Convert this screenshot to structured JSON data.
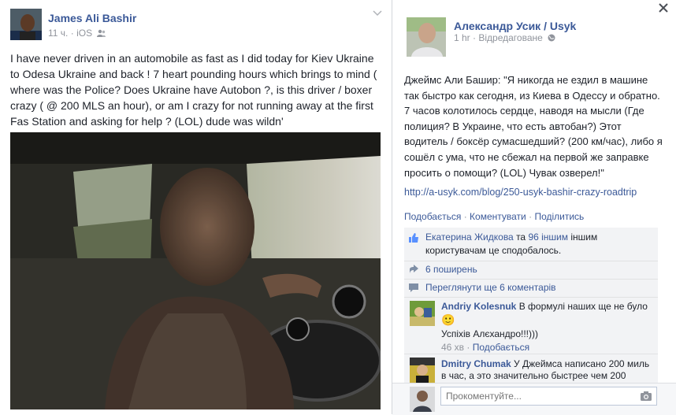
{
  "left_post": {
    "author": "James Ali Bashir",
    "time": "11 ч.",
    "source": "iOS",
    "text": "I have never driven in an automobile as fast as I did today for Kiev Ukraine\nto Odesa Ukraine and back ! 7 heart pounding hours which brings to mind (\nwhere was the Police? Does Ukraine have Autobon ?, is this driver / boxer\ncrazy ( @ 200 MLS an hour), or am I crazy for not running away at the first\nFas Station and asking for help ? (LOL) dude was wildn'"
  },
  "right_post": {
    "author": "Александр Усик / Usyk",
    "time": "1 hr",
    "edited": "Відредаговане",
    "text": "Джеймс Али Башир: \"Я никогда не ездил в машине так быстро как сегодня, из Киева в Одессу и обратно. 7 часов колотилось сердце, наводя на мысли (Где полиция? В Украине, что есть автобан?) Этот водитель / боксёр сумасшедший? (200 км/час), либо я сошёл с ума, что не сбежал на первой же заправке просить о помощи? (LOL) Чувак озверел!\"",
    "link": "http://a-usyk.com/blog/250-usyk-bashir-crazy-roadtrip",
    "actions": {
      "like": "Подобається",
      "comment": "Коментувати",
      "share": "Поділитись",
      "sep": "·"
    }
  },
  "ufi": {
    "likes_name": "Екатерина Жидкова",
    "likes_mid": " та ",
    "likes_others": "96 іншим",
    "likes_tail": " іншим користувачам це сподобалось.",
    "shares": "6 поширень",
    "more_comments": "Переглянути ще 6 коментарів",
    "comments": [
      {
        "author": "Andriy Kolesnuk",
        "text": "В формулі наших ще не було",
        "emoji": "🙂",
        "text2": "Успіхів Алєхандро!!!)))",
        "likes": "46 хв",
        "like_label": "Подобається",
        "sep": "·"
      },
      {
        "author": "Dmitry Chumak",
        "text": "У Джеймса написано 200 миль в час, а это значительно быстрее чем 200"
      }
    ],
    "composer_placeholder": "Прокоментуйте..."
  },
  "icons": {
    "close": "close-icon",
    "chevron": "chevron-down-icon",
    "like": "thumbs-up-icon",
    "share": "share-icon",
    "comment": "comment-icon",
    "camera": "camera-icon",
    "globe": "globe-icon",
    "friends": "friends-icon"
  }
}
